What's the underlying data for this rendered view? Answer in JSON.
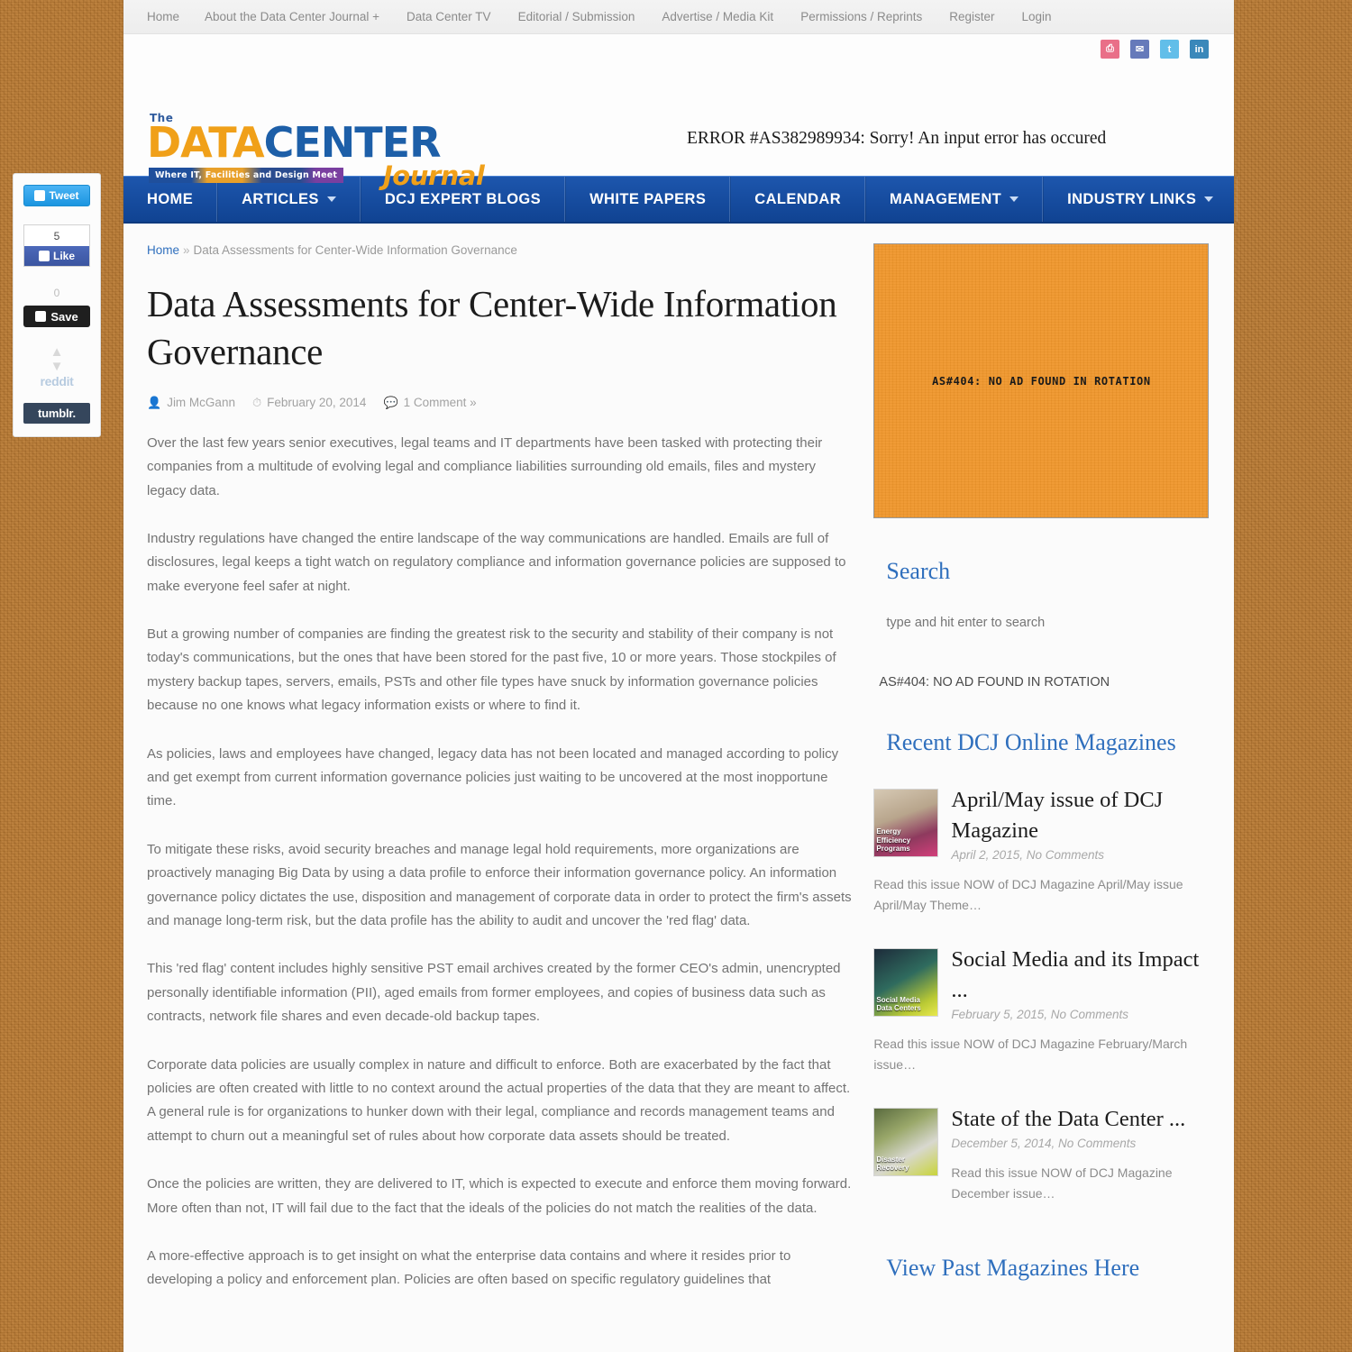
{
  "topbar": {
    "links": [
      "Home",
      "About the Data Center Journal +",
      "Data Center TV",
      "Editorial / Submission",
      "Advertise / Media Kit",
      "Permissions / Reprints",
      "Register",
      "Login"
    ]
  },
  "share_icons": [
    {
      "name": "print-icon",
      "glyph": "⎙"
    },
    {
      "name": "newsletter-icon",
      "glyph": "✉"
    },
    {
      "name": "twitter-icon",
      "glyph": "t"
    },
    {
      "name": "linkedin-icon",
      "glyph": "in"
    }
  ],
  "logo": {
    "the": "The",
    "data": "DATA",
    "center": "CENTER",
    "tagline": "Where IT, Facilities and Design Meet",
    "journal": "Journal"
  },
  "header": {
    "error": "ERROR #AS382989934: Sorry! An input error has occured"
  },
  "mainnav": [
    {
      "label": "HOME",
      "caret": false
    },
    {
      "label": "ARTICLES",
      "caret": true
    },
    {
      "label": "DCJ EXPERT BLOGS",
      "caret": false
    },
    {
      "label": "WHITE PAPERS",
      "caret": false
    },
    {
      "label": "CALENDAR",
      "caret": false
    },
    {
      "label": "MANAGEMENT",
      "caret": true
    },
    {
      "label": "INDUSTRY LINKS",
      "caret": true
    }
  ],
  "breadcrumb": {
    "home": "Home",
    "separator": "»",
    "current": "Data Assessments for Center-Wide Information Governance"
  },
  "article": {
    "title": "Data Assessments for Center-Wide Information Governance",
    "author": "Jim McGann",
    "date": "February 20, 2014",
    "comments": "1 Comment »",
    "paragraphs": [
      "Over the last few years senior executives, legal teams and IT departments have been tasked with protecting their companies from a multitude of evolving legal and compliance liabilities surrounding old emails, files and mystery legacy data.",
      "Industry regulations have changed the entire landscape of the way communications are handled. Emails are full of disclosures, legal keeps a tight watch on regulatory compliance and information governance policies are supposed to make everyone feel safer at night.",
      "But a growing number of companies are finding the greatest risk to the security and stability of their company is not today's communications, but the ones that have been stored for the past five, 10 or more years. Those stockpiles of mystery backup tapes, servers, emails, PSTs and other file types have snuck by information governance policies because no one knows what legacy information exists or where to find it.",
      "As policies, laws and employees have changed, legacy data has not been located and managed according to policy and get exempt from current information governance policies just waiting to be uncovered at the most inopportune time.",
      "To mitigate these risks, avoid security breaches and manage legal hold requirements, more organizations are proactively managing Big Data by using a data profile to enforce their information governance policy. An information governance policy dictates the use, disposition and management of corporate data in order to protect the firm's assets and manage long-term risk, but the data profile has the ability to audit and uncover the 'red flag' data.",
      "This 'red flag' content includes highly sensitive PST email archives created by the former CEO's admin, unencrypted personally identifiable information (PII), aged emails from former employees, and copies of business data such as contracts, network file shares and even decade-old backup tapes.",
      "Corporate data policies are usually complex in nature and difficult to enforce. Both are exacerbated by the fact that policies are often created with little to no context around the actual properties of the data that they are meant to affect. A general rule is for organizations to hunker down with their legal, compliance and records management teams and attempt to churn out a meaningful set of rules about how corporate data assets should be treated.",
      "Once the policies are written, they are delivered to IT, which is expected to execute and enforce them moving forward. More often than not, IT will fail due to the fact that the ideals of the policies do not match the realities of the data.",
      "A more-effective approach is to get insight on what the enterprise data contains and where it resides prior to developing a policy and enforcement plan. Policies are often based on specific regulatory guidelines that"
    ]
  },
  "sidebar": {
    "ad_banner_text": "AS#404: NO AD FOUND IN ROTATION",
    "search_title": "Search",
    "search_placeholder": "type and hit enter to search",
    "ad_text_line": "AS#404: NO AD FOUND IN ROTATION",
    "magazines_title": "Recent DCJ Online Magazines",
    "magazines": [
      {
        "title": "April/May issue of DCJ Magazine",
        "date": "April 2, 2015, No Comments",
        "excerpt": "Read this issue NOW of DCJ Magazine April/May issue April/May Theme…",
        "thumb_label": "Energy Efficiency Programs"
      },
      {
        "title": "Social Media and its Impact ...",
        "date": "February 5, 2015, No Comments",
        "excerpt": "Read this issue NOW of DCJ Magazine February/March issue…",
        "thumb_label": "Social Media Data Centers"
      },
      {
        "title": "State of the Data Center ...",
        "date": "December 5, 2014, No Comments",
        "excerpt": "Read this issue NOW of DCJ Magazine December issue…",
        "thumb_label": "Disaster Recovery"
      }
    ],
    "view_past": "View Past Magazines Here"
  },
  "social_rail": {
    "tweet_label": "Tweet",
    "fb_count": "5",
    "like_label": "Like",
    "pin_count": "0",
    "save_label": "Save",
    "reddit_label": "reddit",
    "tumblr_label": "tumblr."
  }
}
